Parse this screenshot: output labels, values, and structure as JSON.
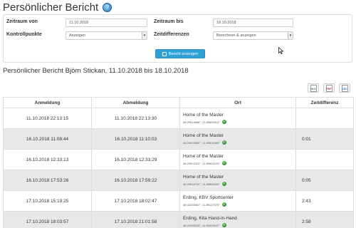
{
  "page": {
    "title": "Persönlicher Bericht"
  },
  "filter": {
    "zeitraum_von_label": "Zeitraum von",
    "zeitraum_von_value": "11.10.2018",
    "zeitraum_bis_label": "Zeitraum bis",
    "zeitraum_bis_value": "18.10.2018",
    "kontrollpunkte_label": "Kontrollpunkte",
    "kontrollpunkte_value": "Anzeigen",
    "zeitdifferenzen_label": "Zeitdifferenzen",
    "zeitdifferenzen_value": "Berechnen & anzeigen",
    "submit_label": "Bericht erzeugen"
  },
  "report": {
    "subtitle": "Persönlicher Bericht Björn Stickan, 11.10.2018 bis 18.10.2018",
    "exports": [
      {
        "label": "XLS",
        "icon": "excel-export-icon"
      },
      {
        "label": "PDF",
        "icon": "pdf-export-icon"
      },
      {
        "label": "CSV",
        "icon": "csv-export-icon"
      }
    ]
  },
  "table": {
    "headers": [
      "Anmeldung",
      "Abmeldung",
      "Ort",
      "Zeitdifferenz"
    ],
    "rows": [
      {
        "anmeldung": "11.10.2018 22:13:15",
        "abmeldung": "11.10.2018 22:13:30",
        "ort": "Home of the Master",
        "coords": "48.29914668°, 11.89504514°",
        "diff": ""
      },
      {
        "anmeldung": "16.10.2018 11:08:44",
        "abmeldung": "16.10.2018 11:10:03",
        "ort": "Home of the Master",
        "coords": "48.29919663°, 11.89514469°",
        "diff": "0:01"
      },
      {
        "anmeldung": "16.10.2018 12:33:13",
        "abmeldung": "16.10.2018 12:33:29",
        "ort": "Home of the Master",
        "coords": "48.29921022°, 11.89503103°",
        "diff": ""
      },
      {
        "anmeldung": "16.10.2018 17:53:26",
        "abmeldung": "16.10.2018 17:59:22",
        "ort": "Home of the Master",
        "coords": "48.29915732°, 11.89509160°",
        "diff": "0:05"
      },
      {
        "anmeldung": "17.10.2018 15:19:25",
        "abmeldung": "17.10.2018 18:02:47",
        "ort": "Erding, KBV Sportcenter",
        "coords": "48.32205987°, 11.89127075°",
        "diff": "2:43"
      },
      {
        "anmeldung": "17.10.2018 18:03:57",
        "abmeldung": "17.10.2018 21:01:58",
        "ort": "Erding, Kita Hand-in-Hand",
        "coords": "48.29435015°, 11.90429647°",
        "diff": "2:58"
      }
    ]
  },
  "colors": {
    "primary_button": "#31a0d6",
    "row_alt": "#e8e8e8",
    "border": "#dddddd"
  }
}
